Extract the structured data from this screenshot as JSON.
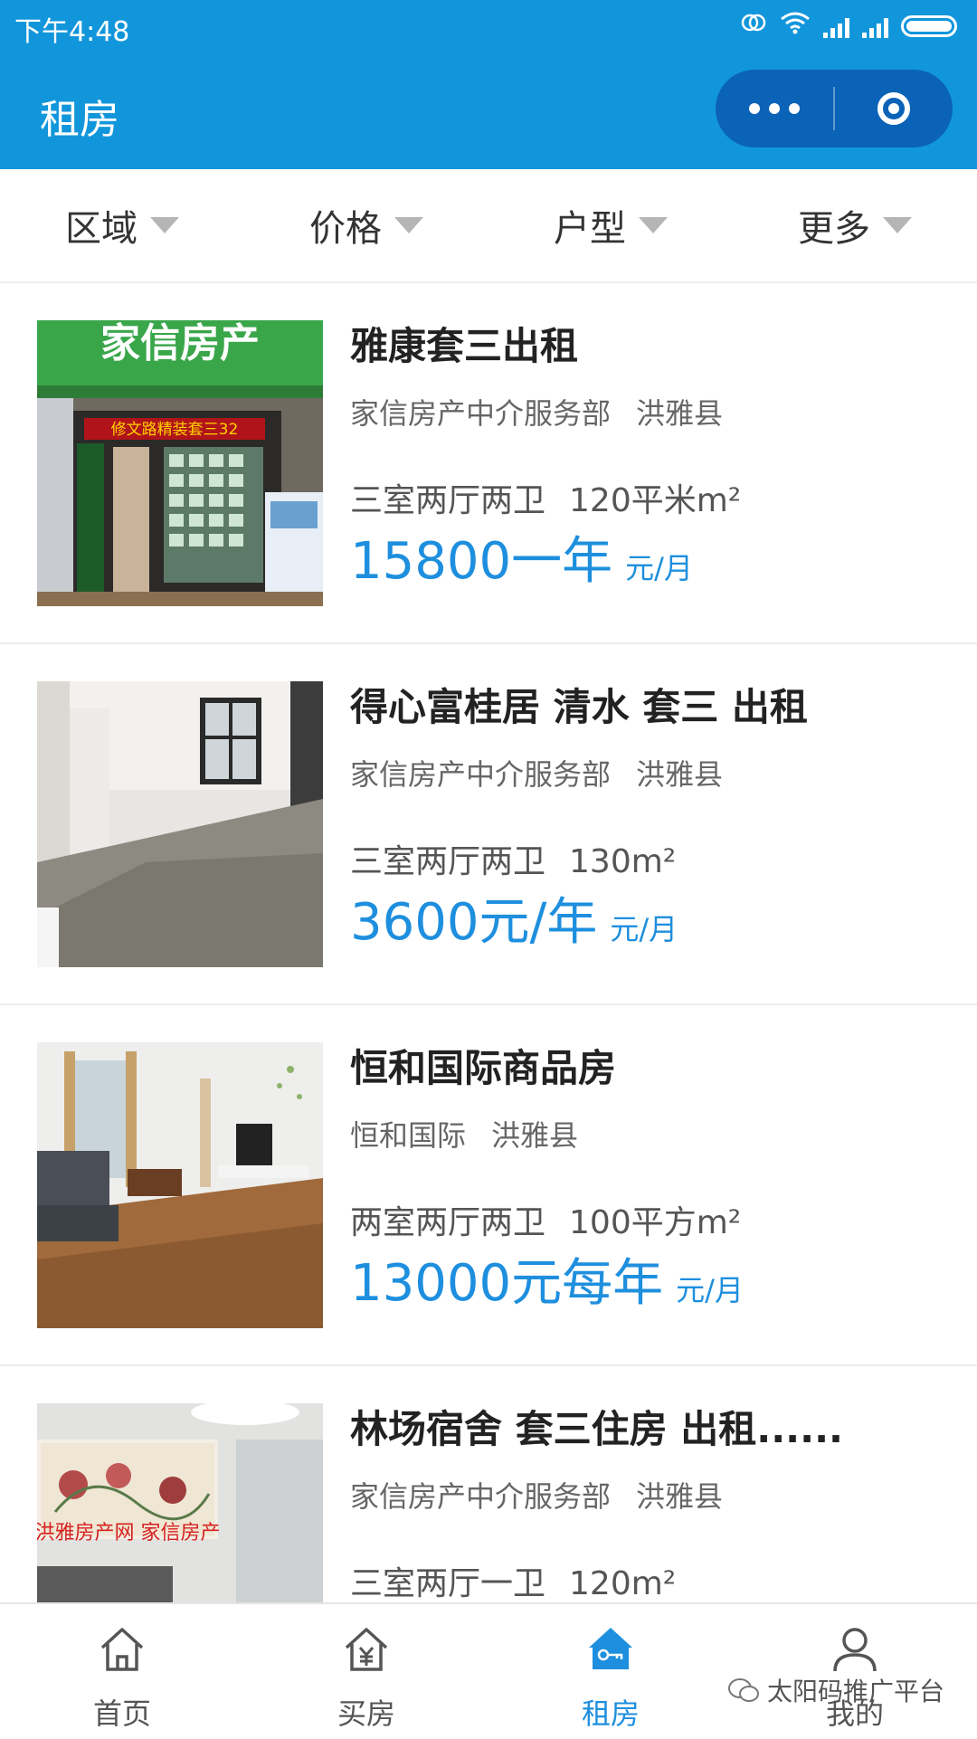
{
  "status_bar": {
    "time": "下午4:48"
  },
  "header": {
    "title": "租房"
  },
  "filters": [
    {
      "label": "区域"
    },
    {
      "label": "价格"
    },
    {
      "label": "户型"
    },
    {
      "label": "更多"
    }
  ],
  "listings": [
    {
      "title": "雅康套三出租",
      "agency": "家信房产中介服务部",
      "county": "洪雅县",
      "layout": "三室两厅两卫",
      "area": "120平米m²",
      "price": "15800一年",
      "unit": "元/月",
      "photo_sign": "家信房产",
      "photo_banner": "修文路精装套三32"
    },
    {
      "title": "得心富桂居 清水 套三 出租",
      "agency": "家信房产中介服务部",
      "county": "洪雅县",
      "layout": "三室两厅两卫",
      "area": "130m²",
      "price": "3600元/年",
      "unit": "元/月"
    },
    {
      "title": "恒和国际商品房",
      "agency": "恒和国际",
      "county": "洪雅县",
      "layout": "两室两厅两卫",
      "area": "100平方m²",
      "price": "13000元每年",
      "unit": "元/月"
    },
    {
      "title": "林场宿舍 套三住房 出租......",
      "agency": "家信房产中介服务部",
      "county": "洪雅县",
      "layout": "三室两厅一卫",
      "area": "120m²",
      "photo_text": "洪雅房产网 家信房产"
    }
  ],
  "tabbar": [
    {
      "label": "首页",
      "icon": "home-icon"
    },
    {
      "label": "买房",
      "icon": "buy-house-icon"
    },
    {
      "label": "租房",
      "icon": "rent-house-icon",
      "active": true
    },
    {
      "label": "我的",
      "icon": "user-icon"
    }
  ],
  "watermark": "太阳码推广平台",
  "colors": {
    "primary": "#1296db",
    "price": "#1e8fde"
  }
}
